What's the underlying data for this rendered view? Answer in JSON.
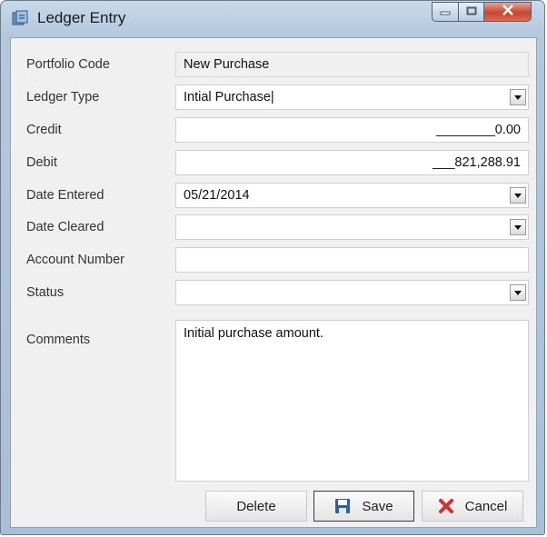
{
  "window": {
    "title": "Ledger Entry",
    "icon": "ledger-app-icon",
    "caption_buttons": [
      "minimize-icon",
      "maximize-icon",
      "close-icon"
    ]
  },
  "form": {
    "portfolio_code": {
      "label": "Portfolio Code",
      "value": "New Purchase"
    },
    "ledger_type": {
      "label": "Ledger Type",
      "value": "Intial Purchase|"
    },
    "credit": {
      "label": "Credit",
      "value": "________0.00"
    },
    "debit": {
      "label": "Debit",
      "value": "___821,288.91"
    },
    "date_entered": {
      "label": "Date Entered",
      "value": "05/21/2014"
    },
    "date_cleared": {
      "label": "Date Cleared",
      "value": ""
    },
    "account_number": {
      "label": "Account Number",
      "value": ""
    },
    "status": {
      "label": "Status",
      "value": ""
    },
    "comments": {
      "label": "Comments",
      "value": "Initial purchase amount."
    }
  },
  "buttons": {
    "delete": "Delete",
    "save": "Save",
    "cancel": "Cancel"
  },
  "colors": {
    "frame": "#b4c8dd",
    "client_bg": "#f0f0f0",
    "close_button": "#c8452d",
    "save_icon": "#2b5fa8",
    "cancel_icon": "#d0312d"
  }
}
